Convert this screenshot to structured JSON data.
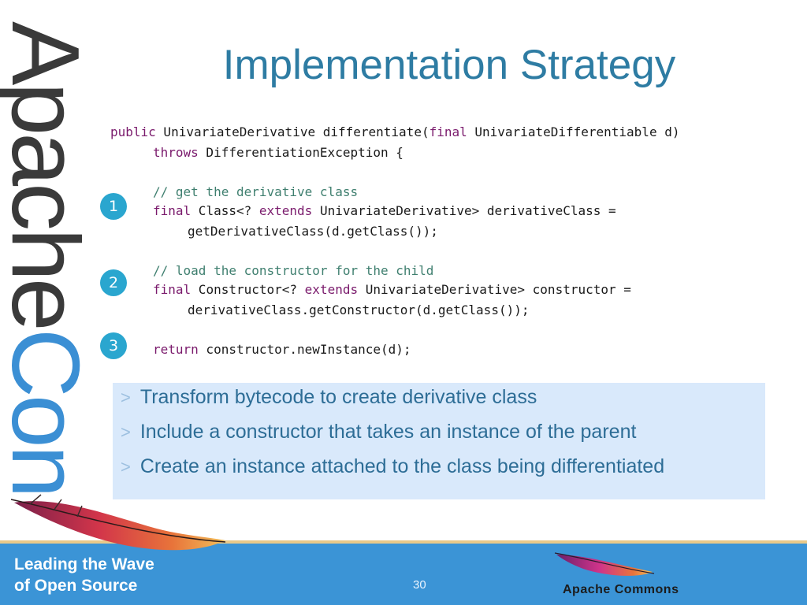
{
  "brand": {
    "part1": "Apache",
    "part2": "Con"
  },
  "slide": {
    "title": "Implementation Strategy",
    "page_number": "30"
  },
  "code": {
    "line1_kw": "public",
    "line1_rest": " UnivariateDerivative differentiate(",
    "line1_kw2": "final",
    "line1_rest2": " UnivariateDifferentiable d)",
    "line2_kw": "throws",
    "line2_rest": " DifferentiationException {",
    "comment1": "// get the derivative class",
    "line4_kw": "final",
    "line4_mid": " Class<? ",
    "line4_kw2": "extends",
    "line4_rest": " UnivariateDerivative> derivativeClass =",
    "line5": "getDerivativeClass(d.getClass());",
    "comment2": "// load the constructor for the child",
    "line7_kw": "final",
    "line7_mid": " Constructor<? ",
    "line7_kw2": "extends",
    "line7_rest": " UnivariateDerivative> constructor =",
    "line8": "derivativeClass.getConstructor(d.getClass());",
    "line9_kw": "return",
    "line9_rest": " constructor.newInstance(d);"
  },
  "steps": [
    "1",
    "2",
    "3"
  ],
  "bullets": [
    "Transform bytecode to create derivative class",
    "Include a constructor that takes an instance of the parent",
    "Create an instance attached to the class being differentiated"
  ],
  "footer": {
    "tagline_line1": "Leading the Wave",
    "tagline_line2": "of Open Source",
    "commons_label": "Apache Commons"
  },
  "colors": {
    "title": "#2e7ca3",
    "badge": "#2aa6cf",
    "bullet_box": "#d9e9fb",
    "footer": "#3b94d6"
  },
  "icons": [
    "feather-logo-icon",
    "commons-feather-icon"
  ]
}
